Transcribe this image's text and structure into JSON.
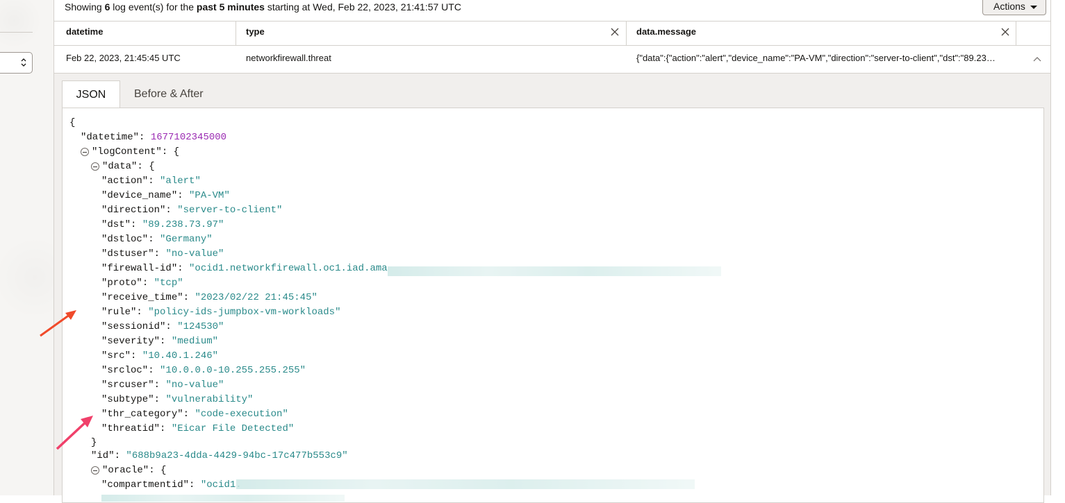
{
  "summary": {
    "prefix": "Showing ",
    "count": "6",
    "middle": " log event(s) for the ",
    "range": "past 5 minutes",
    "suffix": " starting at Wed, Feb 22, 2023, 21:41:57 UTC"
  },
  "actions_label": "Actions",
  "columns": [
    "datetime",
    "type",
    "data.message"
  ],
  "row": {
    "datetime": "Feb 22, 2023, 21:45:45 UTC",
    "type": "networkfirewall.threat",
    "message": "{\"data\":{\"action\":\"alert\",\"device_name\":\"PA-VM\",\"direction\":\"server-to-client\",\"dst\":\"89.23…"
  },
  "tabs": [
    "JSON",
    "Before & After"
  ],
  "json": {
    "open_brace": "{",
    "datetime_key": "\"datetime\"",
    "datetime_val": "1677102345000",
    "logcontent_key": "\"logContent\"",
    "data_key": "\"data\"",
    "fields": [
      {
        "k": "\"action\"",
        "v": "\"alert\""
      },
      {
        "k": "\"device_name\"",
        "v": "\"PA-VM\""
      },
      {
        "k": "\"direction\"",
        "v": "\"server-to-client\""
      },
      {
        "k": "\"dst\"",
        "v": "\"89.238.73.97\""
      },
      {
        "k": "\"dstloc\"",
        "v": "\"Germany\""
      },
      {
        "k": "\"dstuser\"",
        "v": "\"no-value\""
      },
      {
        "k": "\"firewall-id\"",
        "v": "\"ocid1.networkfirewall.oc1.iad.ama"
      },
      {
        "k": "\"proto\"",
        "v": "\"tcp\""
      },
      {
        "k": "\"receive_time\"",
        "v": "\"2023/02/22 21:45:45\""
      },
      {
        "k": "\"rule\"",
        "v": "\"policy-ids-jumpbox-vm-workloads\""
      },
      {
        "k": "\"sessionid\"",
        "v": "\"124530\""
      },
      {
        "k": "\"severity\"",
        "v": "\"medium\""
      },
      {
        "k": "\"src\"",
        "v": "\"10.40.1.246\""
      },
      {
        "k": "\"srcloc\"",
        "v": "\"10.0.0.0-10.255.255.255\""
      },
      {
        "k": "\"srcuser\"",
        "v": "\"no-value\""
      },
      {
        "k": "\"subtype\"",
        "v": "\"vulnerability\""
      },
      {
        "k": "\"thr_category\"",
        "v": "\"code-execution\""
      },
      {
        "k": "\"threatid\"",
        "v": "\"Eicar File Detected\""
      }
    ],
    "close_brace": "}",
    "id_key": "\"id\"",
    "id_val": "\"688b9a23-4dda-4429-94bc-17c477b553c9\"",
    "oracle_key": "\"oracle\"",
    "compartmentid_key": "\"compartmentid\"",
    "compartmentid_val": "\"ocid1."
  },
  "colors": {
    "string": "#2a8a8a",
    "number": "#9b2bb3",
    "arrow1": "#f04a2a",
    "arrow2": "#f0406a"
  }
}
